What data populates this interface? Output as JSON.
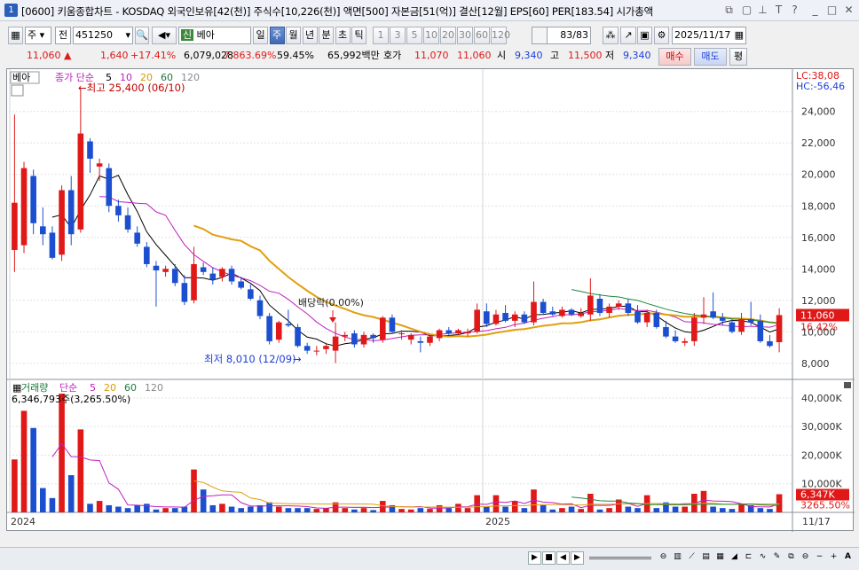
{
  "title": {
    "badge": "1",
    "text": "[0600] 키움종합차트 - KOSDAQ 외국인보유[42(천)] 주식수[10,226(천)] 액면[500] 자본금[51(억)] 결산[12월] EPS[60] PER[183.54] 시가총액",
    "icons": [
      "window-restore-icon",
      "window-copy-icon",
      "pin-icon",
      "font-icon",
      "help-icon",
      "minimize-icon",
      "maximize-icon",
      "close-icon"
    ]
  },
  "toolbar": {
    "period_select": "주",
    "period_unit": "전",
    "code": "451250",
    "stock_badge": "신",
    "stock_name": "베아",
    "timeframes": [
      "일",
      "주",
      "월",
      "년",
      "분",
      "초",
      "틱"
    ],
    "active_timeframe": "주",
    "intervals": [
      "1",
      "3",
      "5",
      "10",
      "20",
      "30",
      "60",
      "120"
    ],
    "count": "83/83",
    "date": "2025/11/17"
  },
  "quote": {
    "price": "11,060",
    "arrow": "▲",
    "change": "1,640",
    "change_pct": "+17.41%",
    "volume": "6,079,028",
    "volume_pct": "7,863.69%",
    "turnover": "59.45%",
    "amount": "65,992백만",
    "hoga_label": "호가",
    "ask": "11,070",
    "bid": "11,060",
    "open_label": "시",
    "open": "9,340",
    "high_label": "고",
    "high": "11,500",
    "low_label": "저",
    "low": "9,340",
    "buy_label": "매수",
    "sell_label": "매도",
    "avg_label": "평"
  },
  "price_panel": {
    "legend_name": "베아",
    "legend_type": "종가 단순",
    "ma_periods": [
      "5",
      "10",
      "20",
      "60",
      "120"
    ],
    "ma_colors": [
      "#000000",
      "#c020c0",
      "#d89c00",
      "#1e7a3a",
      "#8a8a8a"
    ],
    "lc_label": "LC:38,08",
    "hc_label": "HC:-56,46",
    "high_annot": "←최고 25,400 (06/10)",
    "low_annot": "최저 8,010 (12/09)",
    "low_arrow": "→",
    "dividend_annot": "배당락(0.00%)",
    "current_price_tag": "11,060",
    "current_pct_tag": "16.42%",
    "yaxis_ticks": [
      "24,000",
      "22,000",
      "20,000",
      "18,000",
      "16,000",
      "14,000",
      "12,000",
      "10,000",
      "8,000"
    ]
  },
  "volume_panel": {
    "legend_name": "거래량",
    "legend_type": "단순",
    "ma_periods": [
      "5",
      "20",
      "60",
      "120"
    ],
    "value_label": "6,346,793주(3,265.50%)",
    "current_tag": "6,347K",
    "current_pct_tag": "3265.50%",
    "yaxis_ticks": [
      "40,000K",
      "30,000K",
      "20,000K",
      "10,000K"
    ]
  },
  "xaxis": {
    "labels": [
      "2024",
      "2025"
    ],
    "right_label": "11/17"
  },
  "colors": {
    "up": "#e01818",
    "down": "#1c4fd0",
    "ma5": "#000000",
    "ma10": "#c020c0",
    "ma20": "#e0a010",
    "ma60": "#1e8a3a"
  },
  "chart_data": {
    "type": "candlestick",
    "ylim": [
      7200,
      25900
    ],
    "candles": [
      {
        "o": 15200,
        "h": 23800,
        "l": 13800,
        "c": 18200
      },
      {
        "o": 15500,
        "h": 20800,
        "l": 15000,
        "c": 20400
      },
      {
        "o": 19900,
        "h": 20300,
        "l": 16200,
        "c": 16900
      },
      {
        "o": 16700,
        "h": 17900,
        "l": 15500,
        "c": 16200
      },
      {
        "o": 16300,
        "h": 16700,
        "l": 14600,
        "c": 14700
      },
      {
        "o": 14900,
        "h": 19300,
        "l": 14500,
        "c": 19000
      },
      {
        "o": 19000,
        "h": 19900,
        "l": 15500,
        "c": 16200
      },
      {
        "o": 16500,
        "h": 25400,
        "l": 16300,
        "c": 22600
      },
      {
        "o": 22100,
        "h": 22300,
        "l": 20100,
        "c": 21000
      },
      {
        "o": 20500,
        "h": 21000,
        "l": 19600,
        "c": 20700
      },
      {
        "o": 20400,
        "h": 20700,
        "l": 17600,
        "c": 18000
      },
      {
        "o": 18000,
        "h": 18400,
        "l": 17000,
        "c": 17400
      },
      {
        "o": 17400,
        "h": 17900,
        "l": 16300,
        "c": 16500
      },
      {
        "o": 16300,
        "h": 16700,
        "l": 15400,
        "c": 15600
      },
      {
        "o": 15400,
        "h": 15700,
        "l": 14100,
        "c": 14300
      },
      {
        "o": 14200,
        "h": 14500,
        "l": 11600,
        "c": 13900
      },
      {
        "o": 13800,
        "h": 14200,
        "l": 13500,
        "c": 14000
      },
      {
        "o": 14000,
        "h": 14300,
        "l": 12900,
        "c": 13100
      },
      {
        "o": 13100,
        "h": 13600,
        "l": 11700,
        "c": 11900
      },
      {
        "o": 12000,
        "h": 15400,
        "l": 11800,
        "c": 14300
      },
      {
        "o": 14100,
        "h": 14400,
        "l": 13600,
        "c": 13800
      },
      {
        "o": 13700,
        "h": 14100,
        "l": 13000,
        "c": 13300
      },
      {
        "o": 13500,
        "h": 14100,
        "l": 13200,
        "c": 14000
      },
      {
        "o": 14000,
        "h": 14200,
        "l": 13000,
        "c": 13200
      },
      {
        "o": 13200,
        "h": 13500,
        "l": 12700,
        "c": 12800
      },
      {
        "o": 12700,
        "h": 13000,
        "l": 12000,
        "c": 12100
      },
      {
        "o": 12000,
        "h": 12300,
        "l": 10800,
        "c": 11000
      },
      {
        "o": 11000,
        "h": 11200,
        "l": 9200,
        "c": 9400
      },
      {
        "o": 9500,
        "h": 10700,
        "l": 9300,
        "c": 10600
      },
      {
        "o": 10500,
        "h": 11400,
        "l": 10300,
        "c": 10400
      },
      {
        "o": 10300,
        "h": 10500,
        "l": 9000,
        "c": 9100
      },
      {
        "o": 9100,
        "h": 9300,
        "l": 8600,
        "c": 8800
      },
      {
        "o": 8800,
        "h": 9100,
        "l": 8500,
        "c": 8800
      },
      {
        "o": 8900,
        "h": 9300,
        "l": 8600,
        "c": 9100
      },
      {
        "o": 8800,
        "h": 10600,
        "l": 8010,
        "c": 9700
      },
      {
        "o": 9700,
        "h": 10000,
        "l": 9400,
        "c": 9800
      },
      {
        "o": 9900,
        "h": 10100,
        "l": 9000,
        "c": 9200
      },
      {
        "o": 9200,
        "h": 10000,
        "l": 9000,
        "c": 9800
      },
      {
        "o": 9800,
        "h": 9900,
        "l": 9300,
        "c": 9600
      },
      {
        "o": 9500,
        "h": 11000,
        "l": 9300,
        "c": 10900
      },
      {
        "o": 10900,
        "h": 11100,
        "l": 9900,
        "c": 10000
      },
      {
        "o": 9900,
        "h": 10100,
        "l": 9500,
        "c": 9900
      },
      {
        "o": 9500,
        "h": 9900,
        "l": 9200,
        "c": 9800
      },
      {
        "o": 9400,
        "h": 9700,
        "l": 8700,
        "c": 9300
      },
      {
        "o": 9300,
        "h": 9800,
        "l": 9100,
        "c": 9700
      },
      {
        "o": 9600,
        "h": 10200,
        "l": 9400,
        "c": 10100
      },
      {
        "o": 10100,
        "h": 10300,
        "l": 9800,
        "c": 9900
      },
      {
        "o": 9900,
        "h": 10200,
        "l": 9800,
        "c": 10100
      },
      {
        "o": 9900,
        "h": 10200,
        "l": 9700,
        "c": 10000
      },
      {
        "o": 10000,
        "h": 11800,
        "l": 9900,
        "c": 11400
      },
      {
        "o": 11300,
        "h": 11800,
        "l": 10300,
        "c": 10500
      },
      {
        "o": 10500,
        "h": 11400,
        "l": 10400,
        "c": 11100
      },
      {
        "o": 11200,
        "h": 11700,
        "l": 10600,
        "c": 10700
      },
      {
        "o": 10700,
        "h": 11300,
        "l": 10300,
        "c": 11100
      },
      {
        "o": 11100,
        "h": 11300,
        "l": 10500,
        "c": 10600
      },
      {
        "o": 10600,
        "h": 13200,
        "l": 10400,
        "c": 11900
      },
      {
        "o": 11900,
        "h": 12100,
        "l": 11100,
        "c": 11200
      },
      {
        "o": 11300,
        "h": 11600,
        "l": 11000,
        "c": 11100
      },
      {
        "o": 11000,
        "h": 11600,
        "l": 10900,
        "c": 11400
      },
      {
        "o": 11400,
        "h": 11500,
        "l": 11000,
        "c": 11100
      },
      {
        "o": 11000,
        "h": 11500,
        "l": 10900,
        "c": 11200
      },
      {
        "o": 11100,
        "h": 13400,
        "l": 10700,
        "c": 12300
      },
      {
        "o": 12100,
        "h": 12400,
        "l": 11000,
        "c": 11200
      },
      {
        "o": 11200,
        "h": 11800,
        "l": 10900,
        "c": 11600
      },
      {
        "o": 11600,
        "h": 12000,
        "l": 11400,
        "c": 11800
      },
      {
        "o": 11800,
        "h": 12100,
        "l": 11000,
        "c": 11200
      },
      {
        "o": 11300,
        "h": 11700,
        "l": 10500,
        "c": 10600
      },
      {
        "o": 10600,
        "h": 11400,
        "l": 10300,
        "c": 11200
      },
      {
        "o": 11200,
        "h": 11400,
        "l": 10200,
        "c": 10300
      },
      {
        "o": 10300,
        "h": 10700,
        "l": 9600,
        "c": 9700
      },
      {
        "o": 9700,
        "h": 10100,
        "l": 9300,
        "c": 9400
      },
      {
        "o": 9300,
        "h": 9600,
        "l": 9100,
        "c": 9400
      },
      {
        "o": 9400,
        "h": 11200,
        "l": 9100,
        "c": 10900
      },
      {
        "o": 10900,
        "h": 12200,
        "l": 10500,
        "c": 11100
      },
      {
        "o": 11300,
        "h": 12500,
        "l": 10800,
        "c": 10900
      },
      {
        "o": 10900,
        "h": 11200,
        "l": 10400,
        "c": 10700
      },
      {
        "o": 10600,
        "h": 10800,
        "l": 9900,
        "c": 10000
      },
      {
        "o": 10000,
        "h": 11200,
        "l": 9800,
        "c": 10800
      },
      {
        "o": 10800,
        "h": 11900,
        "l": 10400,
        "c": 10600
      },
      {
        "o": 10700,
        "h": 11100,
        "l": 9300,
        "c": 9400
      },
      {
        "o": 9400,
        "h": 9800,
        "l": 9000,
        "c": 9100
      },
      {
        "o": 9340,
        "h": 11500,
        "l": 8700,
        "c": 11060
      }
    ],
    "volume_k": [
      18500,
      35500,
      29500,
      8500,
      5000,
      41500,
      13000,
      29000,
      3000,
      4000,
      2500,
      2000,
      1500,
      2500,
      3000,
      1000,
      1500,
      1500,
      2000,
      15000,
      8000,
      2500,
      3000,
      2000,
      1500,
      2000,
      2500,
      3500,
      2000,
      1500,
      1500,
      1500,
      1200,
      1500,
      3500,
      1500,
      1000,
      1500,
      800,
      4000,
      2500,
      1200,
      1000,
      1500,
      1200,
      2500,
      1500,
      3000,
      1500,
      6000,
      2000,
      6000,
      2000,
      4000,
      1500,
      8000,
      2500,
      1000,
      1500,
      2000,
      1200,
      6500,
      1000,
      1500,
      4500,
      2000,
      1500,
      6000,
      1500,
      3500,
      2000,
      2000,
      6500,
      7500,
      2000,
      1500,
      1200,
      3000,
      2500,
      1500,
      1200,
      6347
    ],
    "ylim_volume_k": [
      0,
      44000
    ]
  }
}
